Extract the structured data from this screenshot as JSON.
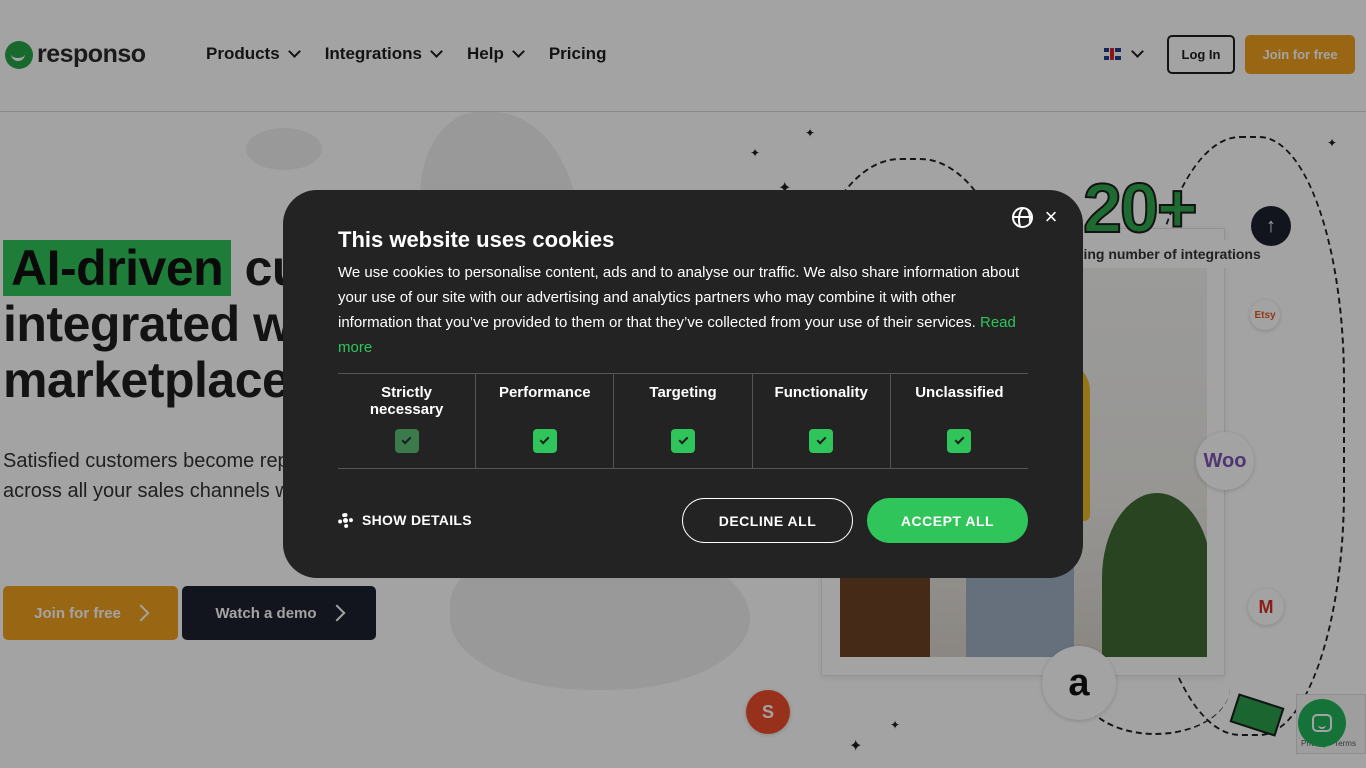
{
  "header": {
    "brand": "responso",
    "nav": [
      {
        "label": "Products",
        "has_dropdown": true
      },
      {
        "label": "Integrations",
        "has_dropdown": true
      },
      {
        "label": "Help",
        "has_dropdown": true
      },
      {
        "label": "Pricing",
        "has_dropdown": false
      }
    ],
    "language_flag": "uk-flag-icon",
    "login_label": "Log In",
    "join_label": "Join for free"
  },
  "hero": {
    "title_highlight": "AI-driven",
    "title_rest": " customer support, integrated with your marketplaces",
    "subtitle": "Satisfied customers become repeat buyers. Boost your customer service across all your sales channels with Responso!",
    "btn_free": "Join for free",
    "btn_demo": "Watch a demo"
  },
  "illustration": {
    "counter": "20+",
    "counter_caption": "growing number of integrations",
    "etsy": "Etsy",
    "woo": "Woo",
    "gmail": "M",
    "amazon": "a",
    "shopee": "S"
  },
  "recaptcha_text": "Privacy - Terms",
  "cookie_modal": {
    "title": "This website uses cookies",
    "text": "We use cookies to personalise content, ads and to analyse our traffic. We also share information about your use of our site with our advertising and analytics partners who may combine it with other information that you’ve provided to them or that they’ve collected from your use of their services.",
    "read_more": "Read more",
    "categories": [
      {
        "label": "Strictly necessary",
        "checked": true,
        "disabled": true
      },
      {
        "label": "Performance",
        "checked": true,
        "disabled": false
      },
      {
        "label": "Targeting",
        "checked": true,
        "disabled": false
      },
      {
        "label": "Functionality",
        "checked": true,
        "disabled": false
      },
      {
        "label": "Unclassified",
        "checked": true,
        "disabled": false
      }
    ],
    "show_details": "SHOW DETAILS",
    "decline_all": "DECLINE ALL",
    "accept_all": "ACCEPT ALL"
  },
  "colors": {
    "brand_green": "#2fc55a",
    "accent_orange": "#f0a11e",
    "dark_navy": "#1d2130",
    "modal_bg": "#232323"
  }
}
